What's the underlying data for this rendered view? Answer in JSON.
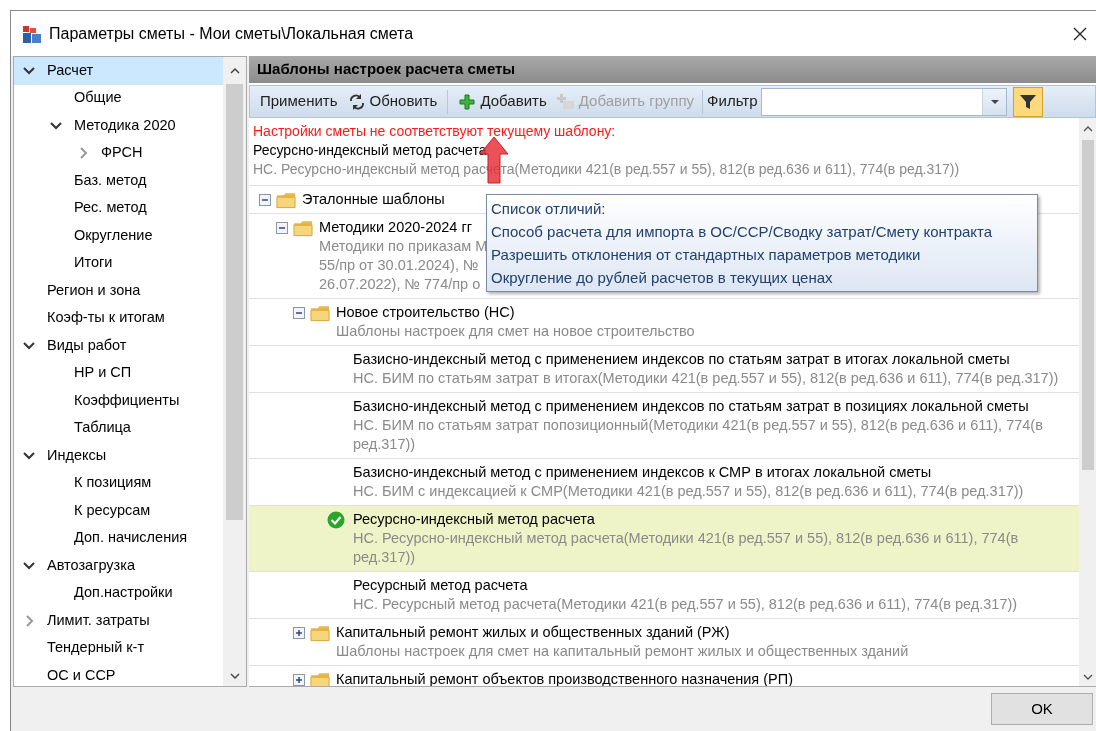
{
  "window": {
    "title": "Параметры сметы - Мои сметы\\Локальная смета"
  },
  "nav": {
    "items": [
      {
        "label": "Расчет",
        "kind": "branch",
        "expanded": true,
        "selected": true,
        "children": [
          {
            "label": "Общие",
            "kind": "leaf",
            "selected": false
          },
          {
            "label": "Методика 2020",
            "kind": "branch",
            "expanded": true,
            "selected": false,
            "children": [
              {
                "label": "ФРСН",
                "kind": "branch",
                "expanded": false,
                "selected": false
              }
            ]
          },
          {
            "label": "Баз. метод",
            "kind": "leaf",
            "selected": false
          },
          {
            "label": "Рес. метод",
            "kind": "leaf",
            "selected": false
          },
          {
            "label": "Округление",
            "kind": "leaf",
            "selected": false
          },
          {
            "label": "Итоги",
            "kind": "leaf",
            "selected": false
          }
        ]
      },
      {
        "label": "Регион и зона",
        "kind": "leaf",
        "selected": false
      },
      {
        "label": "Коэф-ты к итогам",
        "kind": "leaf",
        "selected": false
      },
      {
        "label": "Виды работ",
        "kind": "branch",
        "expanded": true,
        "selected": false,
        "children": [
          {
            "label": "НР и СП",
            "kind": "leaf",
            "selected": false
          },
          {
            "label": "Коэффициенты",
            "kind": "leaf",
            "selected": false
          },
          {
            "label": "Таблица",
            "kind": "leaf",
            "selected": false
          }
        ]
      },
      {
        "label": "Индексы",
        "kind": "branch",
        "expanded": true,
        "selected": false,
        "children": [
          {
            "label": "К позициям",
            "kind": "leaf",
            "selected": false
          },
          {
            "label": "К ресурсам",
            "kind": "leaf",
            "selected": false
          },
          {
            "label": "Доп. начисления",
            "kind": "leaf",
            "selected": false
          }
        ]
      },
      {
        "label": "Автозагрузка",
        "kind": "branch",
        "expanded": true,
        "selected": false,
        "children": [
          {
            "label": "Доп.настройки",
            "kind": "leaf",
            "selected": false
          }
        ]
      },
      {
        "label": "Лимит. затраты",
        "kind": "branch",
        "expanded": false,
        "selected": false
      },
      {
        "label": "Тендерный к-т",
        "kind": "leaf",
        "selected": false
      },
      {
        "label": "ОС и ССР",
        "kind": "leaf",
        "selected": false
      }
    ]
  },
  "panel": {
    "title": "Шаблоны настроек расчета сметы",
    "toolbar": [
      {
        "label": "Применить",
        "kind": "text",
        "disabled": false
      },
      {
        "label": "Обновить",
        "kind": "refresh",
        "disabled": false
      },
      {
        "label": "Добавить",
        "kind": "add",
        "disabled": false
      },
      {
        "label": "Добавить группу",
        "kind": "group",
        "disabled": true
      }
    ],
    "filter": {
      "label": "Фильтр",
      "active": true
    },
    "warning": {
      "message": "Настройки сметы не соответствуют текущему шаблону:",
      "name": "Ресурсно-индексный метод расчета",
      "description": "НС. Ресурсно-индексный метод расчета(Методики 421(в ред.557 и 55), 812(в ред.636 и 611), 774(в ред.317))"
    },
    "templates": [
      {
        "kind": "group",
        "title": "Эталонные шаблоны",
        "expanded": true,
        "children": [
          {
            "kind": "group",
            "title": "Методики 2020-2024 гг",
            "description": [
              "Методики по приказам М",
              "55/пр от 30.01.2024), №",
              "26.07.2022), № 774/пр о"
            ],
            "expanded": true,
            "children": [
              {
                "kind": "group",
                "title": "Новое строительство (НС)",
                "description": [
                  "Шаблоны настроек для смет на новое строительство"
                ],
                "expanded": true,
                "children": [
                  {
                    "kind": "template",
                    "title": "Базисно-индексный метод с применением индексов по статьям затрат в итогах локальной сметы",
                    "description": [
                      "НС. БИМ по статьям затрат в итогах(Методики 421(в ред.557 и 55), 812(в ред.636 и 611), 774(в ред.317))"
                    ],
                    "selected": false
                  },
                  {
                    "kind": "template",
                    "title": "Базисно-индексный метод с применением индексов по статьям затрат в позициях локальной сметы",
                    "description": [
                      "НС. БИМ по статьям затрат попозиционный(Методики 421(в ред.557 и 55), 812(в ред.636 и 611), 774(в ред.317))"
                    ],
                    "selected": false
                  },
                  {
                    "kind": "template",
                    "title": "Базисно-индексный метод с применением индексов к СМР в итогах локальной сметы",
                    "description": [
                      "НС. БИМ с индексацией к СМР(Методики 421(в ред.557 и 55), 812(в ред.636 и 611), 774(в ред.317))"
                    ],
                    "selected": false
                  },
                  {
                    "kind": "template",
                    "title": "Ресурсно-индексный метод расчета",
                    "description": [
                      "НС. Ресурсно-индексный метод расчета(Методики 421(в ред.557 и 55), 812(в ред.636 и 611), 774(в ред.317))"
                    ],
                    "selected": true
                  },
                  {
                    "kind": "template",
                    "title": "Ресурсный метод расчета",
                    "description": [
                      "НС. Ресурсный метод расчета(Методики 421(в ред.557 и 55), 812(в ред.636 и 611), 774(в ред.317))"
                    ],
                    "selected": false
                  }
                ]
              },
              {
                "kind": "group",
                "title": "Капитальный ремонт жилых и общественных зданий (РЖ)",
                "description": [
                  "Шаблоны настроек для смет на капитальный ремонт жилых и общественных зданий"
                ],
                "expanded": false
              },
              {
                "kind": "group",
                "title": "Капитальный ремонт объектов производственного назначения (РП)",
                "expanded": false
              }
            ]
          }
        ]
      }
    ],
    "tooltip": {
      "heading": "Список отличий:",
      "lines": [
        "Способ расчета для импорта в ОС/ССР/Сводку затрат/Смету контракта",
        "Разрешить отклонения от стандартных параметров методики",
        "Округление до рублей расчетов в текущих ценах"
      ]
    }
  },
  "buttons": [
    "OK"
  ]
}
